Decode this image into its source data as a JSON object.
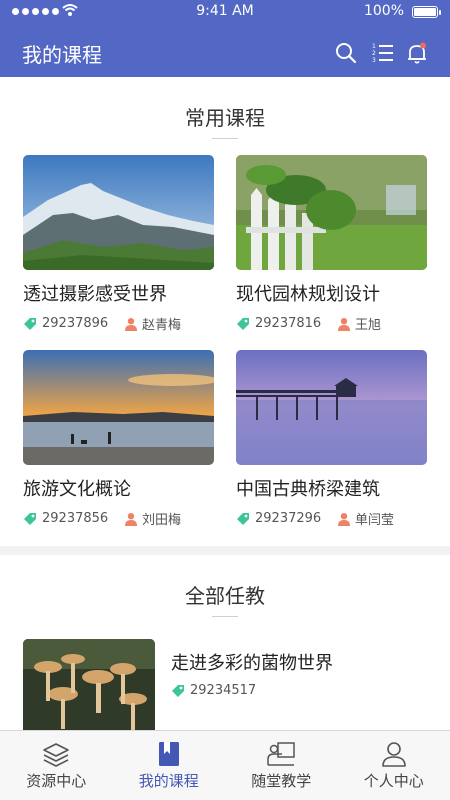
{
  "status_bar": {
    "time": "9:41 AM",
    "battery": "100%"
  },
  "header": {
    "title": "我的课程",
    "icons": [
      "search-icon",
      "numbered-list-icon",
      "bell-icon"
    ]
  },
  "colors": {
    "primary": "#5268c4",
    "active_tab": "#4557b5",
    "tag_green": "#3cc49a",
    "person_orange": "#ee8264"
  },
  "common_courses": {
    "title": "常用课程",
    "courses": [
      {
        "name": "透过摄影感受世界",
        "code": "29237896",
        "teacher": "赵青梅",
        "image": "snowy-mountain-landscape"
      },
      {
        "name": "现代园林规划设计",
        "code": "29237816",
        "teacher": "王旭",
        "image": "garden-fence-plant"
      },
      {
        "name": "旅游文化概论",
        "code": "29237856",
        "teacher": "刘田梅",
        "image": "beach-sunset"
      },
      {
        "name": "中国古典桥梁建筑",
        "code": "29237296",
        "teacher": "单闫莹",
        "image": "pier-pavilion-dusk"
      }
    ]
  },
  "all_teaching": {
    "title": "全部任教",
    "courses": [
      {
        "name": "走进多彩的菌物世界",
        "code": "29234517",
        "image": "mushrooms"
      }
    ]
  },
  "tabbar": {
    "tabs": [
      {
        "label": "资源中心",
        "icon": "layers-icon",
        "active": false
      },
      {
        "label": "我的课程",
        "icon": "bookmark-book-icon",
        "active": true
      },
      {
        "label": "随堂教学",
        "icon": "teacher-board-icon",
        "active": false
      },
      {
        "label": "个人中心",
        "icon": "person-icon",
        "active": false
      }
    ]
  }
}
